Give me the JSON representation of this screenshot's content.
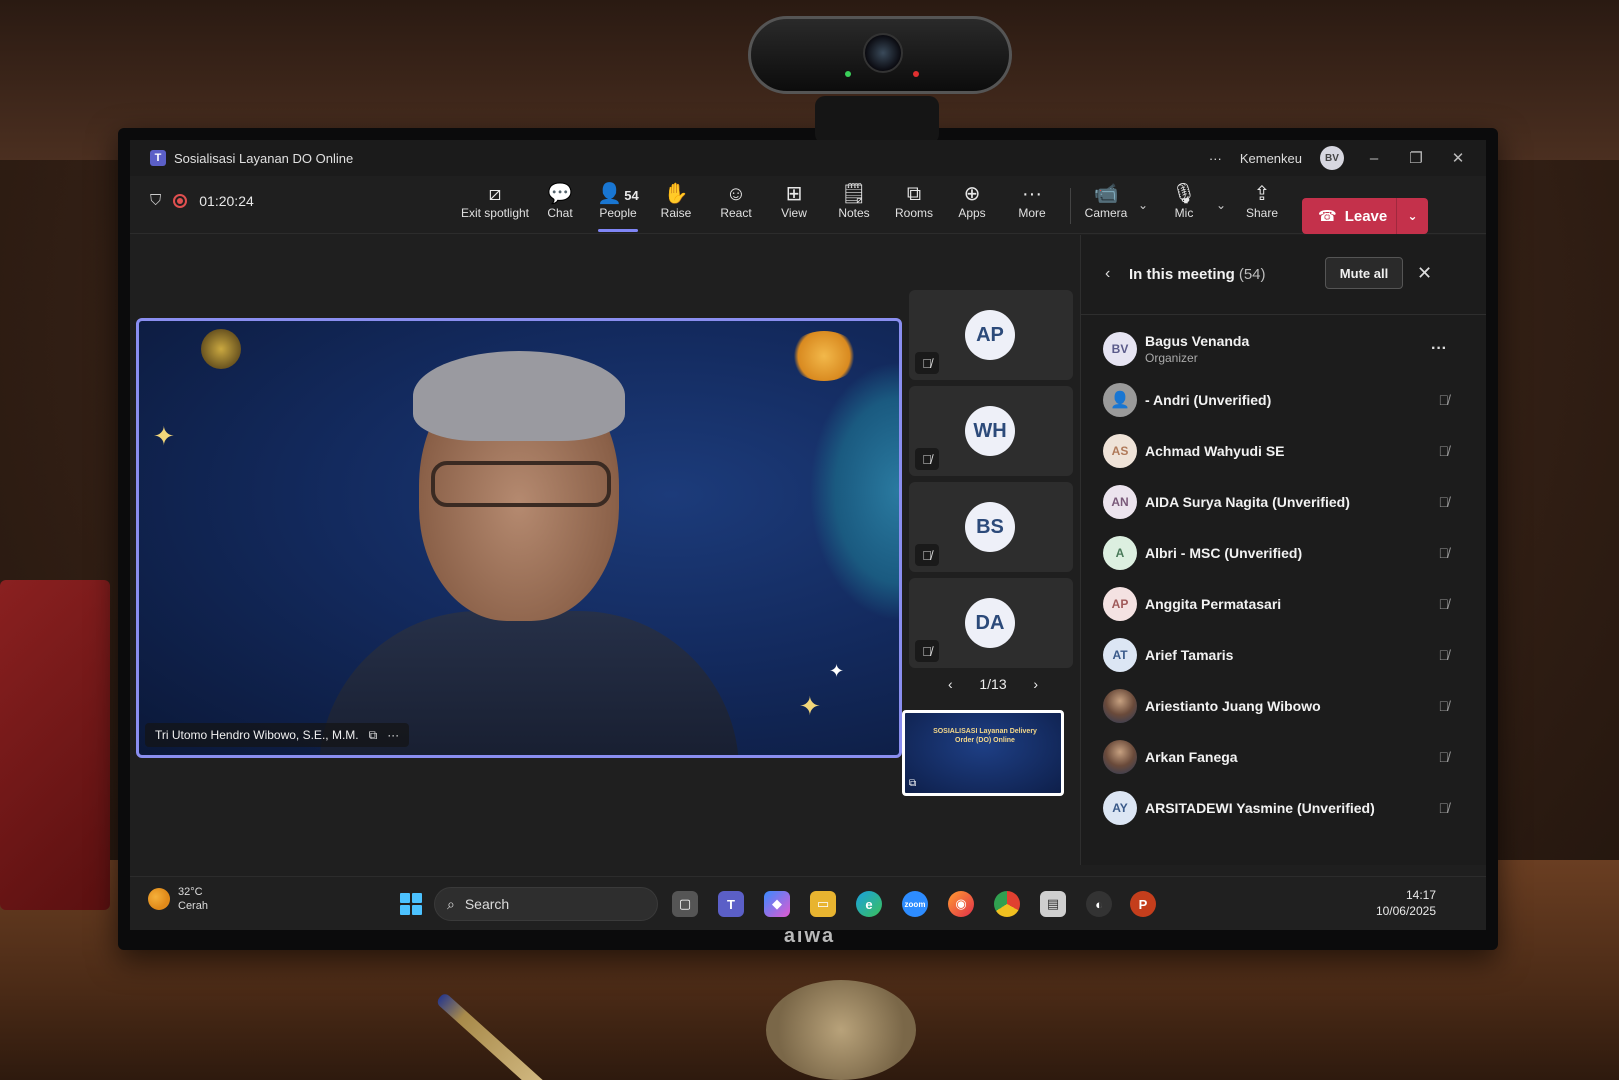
{
  "window": {
    "title": "Sosialisasi Layanan DO Online",
    "org": "Kemenkeu",
    "user_initials": "BV"
  },
  "toolbar": {
    "timer": "01:20:24",
    "buttons": [
      {
        "label": "Exit spotlight",
        "icon": "exit-spotlight-icon"
      },
      {
        "label": "Chat",
        "icon": "chat-icon"
      },
      {
        "label": "People",
        "icon": "people-icon",
        "count": "54",
        "active": true
      },
      {
        "label": "Raise",
        "icon": "hand-icon"
      },
      {
        "label": "React",
        "icon": "smile-icon"
      },
      {
        "label": "View",
        "icon": "grid-icon"
      },
      {
        "label": "Notes",
        "icon": "notes-icon"
      },
      {
        "label": "Rooms",
        "icon": "rooms-icon"
      },
      {
        "label": "Apps",
        "icon": "apps-icon"
      },
      {
        "label": "More",
        "icon": "more-icon"
      },
      {
        "label": "Camera",
        "icon": "camera-icon"
      },
      {
        "label": "Mic",
        "icon": "mic-icon"
      },
      {
        "label": "Share",
        "icon": "share-icon"
      }
    ],
    "leave_label": "Leave"
  },
  "stage": {
    "spotlight_name": "Tri Utomo Hendro Wibowo, S.E., M.M.",
    "tiles": [
      "AP",
      "WH",
      "BS",
      "DA"
    ],
    "pager": "1/13",
    "thumbnail_text": "SOSIALISASI Layanan Delivery Order (DO) Online"
  },
  "panel": {
    "title": "In this meeting",
    "count": "(54)",
    "mute_all_label": "Mute all",
    "participants": [
      {
        "initials": "BV",
        "name": "Bagus Venanda",
        "role": "Organizer"
      },
      {
        "initials": "",
        "name": "- Andri (Unverified)",
        "role": ""
      },
      {
        "initials": "AS",
        "name": "Achmad Wahyudi SE",
        "role": ""
      },
      {
        "initials": "AN",
        "name": "AIDA Surya Nagita (Unverified)",
        "role": ""
      },
      {
        "initials": "A",
        "name": "Albri - MSC (Unverified)",
        "role": ""
      },
      {
        "initials": "AP",
        "name": "Anggita Permatasari",
        "role": ""
      },
      {
        "initials": "AT",
        "name": "Arief Tamaris",
        "role": ""
      },
      {
        "initials": "",
        "name": "Ariestianto Juang Wibowo",
        "role": ""
      },
      {
        "initials": "",
        "name": "Arkan Fanega",
        "role": ""
      },
      {
        "initials": "AY",
        "name": "ARSITADEWI Yasmine (Unverified)",
        "role": ""
      }
    ]
  },
  "taskbar": {
    "temperature": "32°C",
    "weather": "Cerah",
    "search_placeholder": "Search",
    "time": "14:17",
    "date": "10/06/2025"
  },
  "monitor_brand": "aiwa",
  "colors": {
    "accent": "#7f85f5",
    "leave": "#c4314b",
    "teams": "#5b5fc7"
  }
}
